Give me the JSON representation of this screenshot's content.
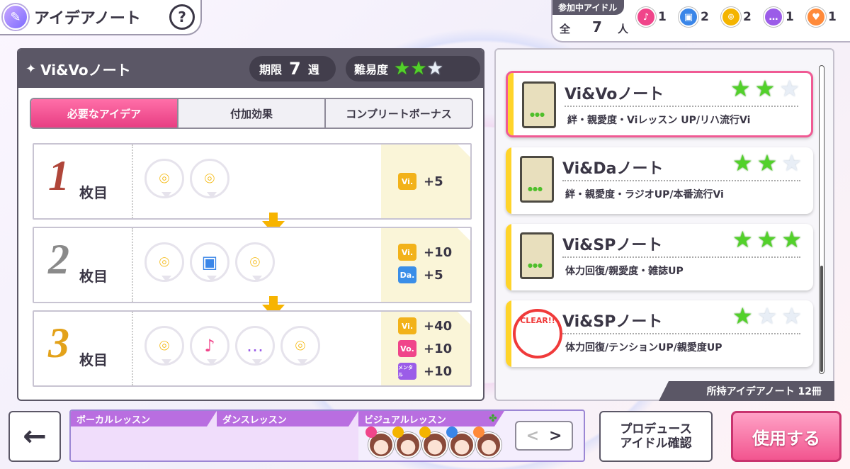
{
  "title": "アイデアノート",
  "help_label": "?",
  "party": {
    "label": "参加中アイドル",
    "all_label": "全",
    "count": "7",
    "unit": "人",
    "groups": [
      {
        "icon": "mic-icon",
        "color": "#f0458a",
        "count": "1"
      },
      {
        "icon": "speaker-icon",
        "color": "#3a86e8",
        "count": "2"
      },
      {
        "icon": "mirror-icon",
        "color": "#f4b400",
        "count": "2"
      },
      {
        "icon": "chat-icon",
        "color": "#9b5ce8",
        "count": "1"
      },
      {
        "icon": "heart-icon",
        "color": "#ff8a3a",
        "count": "1"
      }
    ]
  },
  "note": {
    "name": "Vi&Voノート",
    "deadline_label": "期限",
    "deadline_value": "7",
    "deadline_unit": "週",
    "difficulty_label": "難易度",
    "difficulty": 2,
    "difficulty_max": 3
  },
  "tabs": [
    {
      "label": "必要なアイデア",
      "active": true
    },
    {
      "label": "付加効果",
      "active": false
    },
    {
      "label": "コンプリートボーナス",
      "active": false
    }
  ],
  "steps": [
    {
      "num": "1",
      "suffix": "枚目",
      "num_color": "#b0463a",
      "ideas": [
        "mirror-icon",
        "mirror-icon"
      ],
      "bonuses": [
        {
          "badge": "Vi.",
          "color": "#f2b21a",
          "value": "+5"
        }
      ]
    },
    {
      "num": "2",
      "suffix": "枚目",
      "num_color": "#8a8a8a",
      "ideas": [
        "mirror-icon",
        "speaker-icon",
        "mirror-icon"
      ],
      "bonuses": [
        {
          "badge": "Vi.",
          "color": "#f2b21a",
          "value": "+10"
        },
        {
          "badge": "Da.",
          "color": "#3a8ee8",
          "value": "+5"
        }
      ]
    },
    {
      "num": "3",
      "suffix": "枚目",
      "num_color": "#e3a21a",
      "ideas": [
        "mirror-icon",
        "mic-icon",
        "chat-icon",
        "mirror-icon"
      ],
      "bonuses": [
        {
          "badge": "Vi.",
          "color": "#f2b21a",
          "value": "+40"
        },
        {
          "badge": "Vo.",
          "color": "#f0458a",
          "value": "+10"
        },
        {
          "badge": "メンタル",
          "color": "#9b5ce8",
          "value": "+10"
        }
      ]
    }
  ],
  "notebooks": [
    {
      "name": "Vi&Voノート",
      "stars": 2,
      "desc": "絆・親愛度・Viレッスン UP/リハ流行Vi",
      "selected": true,
      "cleared": false
    },
    {
      "name": "Vi&Daノート",
      "stars": 2,
      "desc": "絆・親愛度・ラジオUP/本番流行Vi",
      "selected": false,
      "cleared": false
    },
    {
      "name": "Vi&SPノート",
      "stars": 3,
      "desc": "体力回復/親愛度・雑誌UP",
      "selected": false,
      "cleared": false
    },
    {
      "name": "Vi&SPノート",
      "stars": 1,
      "desc": "体力回復/テンションUP/親愛度UP",
      "selected": false,
      "cleared": true,
      "clear_label": "CLEAR!!"
    }
  ],
  "owned_label": "所持アイデアノート 12冊",
  "lessons": [
    {
      "label": "ボーカルレッスン"
    },
    {
      "label": "ダンスレッスン"
    },
    {
      "label": "ビジュアルレッスン"
    }
  ],
  "pager": {
    "prev": "<",
    "next": ">"
  },
  "confirm_label_1": "プロデュース",
  "confirm_label_2": "アイドル確認",
  "use_label": "使用する"
}
